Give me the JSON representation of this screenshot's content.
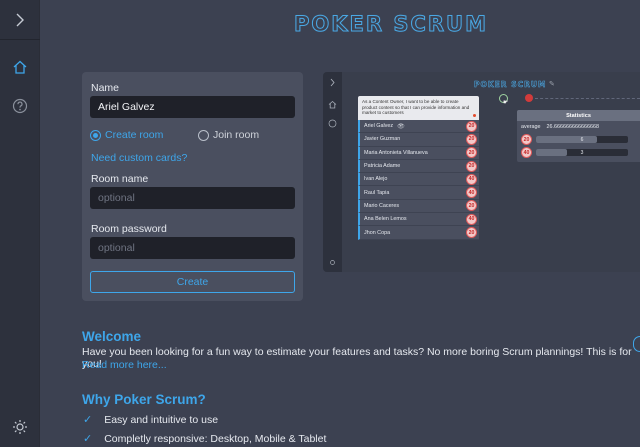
{
  "app": {
    "title": "POKER SCRUM"
  },
  "nav": {
    "toggle_icon": "chevron-right-icon",
    "items": [
      {
        "name": "home",
        "icon": "home-icon",
        "color": "#3ea6ea"
      },
      {
        "name": "help",
        "icon": "help-circle-icon",
        "color": "#8a909c"
      }
    ],
    "theme_icon": "sun-icon"
  },
  "form": {
    "name_label": "Name",
    "name_value": "Ariel Galvez",
    "radio_create": "Create room",
    "radio_join": "Join room",
    "selected": "Create room",
    "custom_cards_link": "Need custom cards?",
    "room_name_label": "Room name",
    "room_name_placeholder": "optional",
    "room_password_label": "Room password",
    "room_password_placeholder": "optional",
    "create_button": "Create"
  },
  "preview": {
    "title": "POKER SCRUM",
    "story": "As a Content Owner, I want to be able to create product content so that I can provide information and market to customers",
    "players": [
      {
        "name": "Ariel Galvez",
        "vote": "20",
        "watching": true
      },
      {
        "name": "Javier Guzman",
        "vote": "20"
      },
      {
        "name": "Maria Antonieta Villanueva",
        "vote": "20"
      },
      {
        "name": "Patricia Adame",
        "vote": "20"
      },
      {
        "name": "Ivan Alejo",
        "vote": "40"
      },
      {
        "name": "Raul Tapia",
        "vote": "40"
      },
      {
        "name": "Mario Caceres",
        "vote": "20"
      },
      {
        "name": "Ana Belen Lemos",
        "vote": "40"
      },
      {
        "name": "Jhon Copa",
        "vote": "20"
      }
    ],
    "statistics": {
      "title": "Statistics",
      "average_label": "average",
      "average_value": "26.666666666666668",
      "rows": [
        {
          "card": "20",
          "count": "6",
          "fraction": 0.667
        },
        {
          "card": "40",
          "count": "3",
          "fraction": 0.333
        }
      ]
    }
  },
  "welcome": {
    "heading": "Welcome",
    "text": "Have you been looking for a fun way to estimate your features and tasks? No more boring Scrum plannings! This is for you!",
    "read_more": "Read more here..."
  },
  "why": {
    "heading": "Why Poker Scrum?",
    "items": [
      "Easy and intuitive to use",
      "Completly responsive: Desktop, Mobile & Tablet"
    ]
  },
  "colors": {
    "accent": "#3ea6ea",
    "background": "#3c4151",
    "card": "#4a4f5f",
    "rail": "#2d313d"
  }
}
